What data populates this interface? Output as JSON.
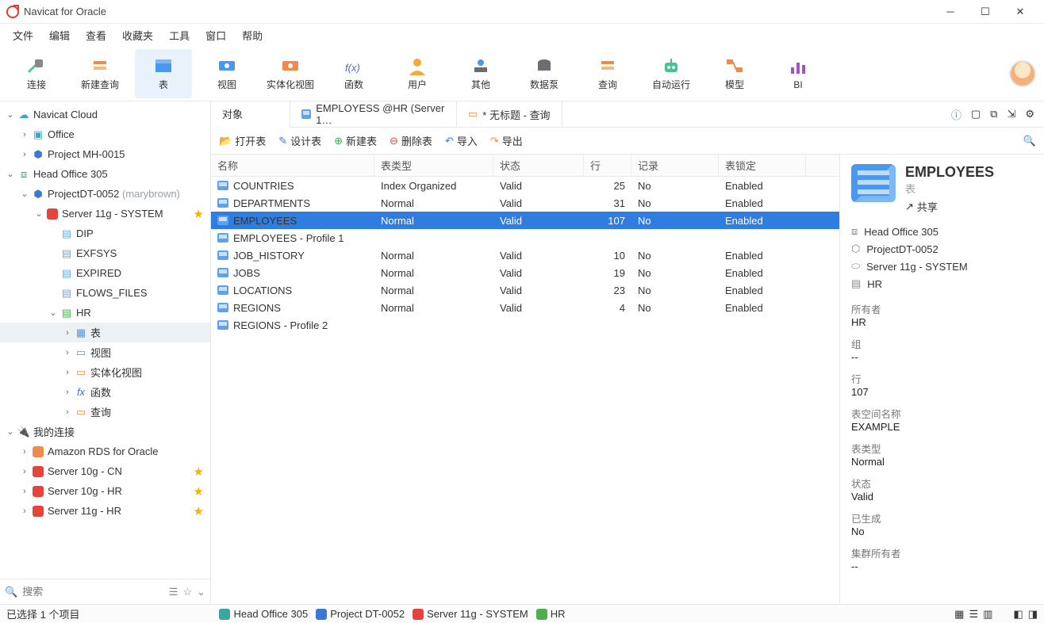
{
  "window": {
    "title": "Navicat for Oracle"
  },
  "menu": [
    "文件",
    "编辑",
    "查看",
    "收藏夹",
    "工具",
    "窗口",
    "帮助"
  ],
  "toolbar": [
    {
      "label": "连接",
      "icon": "plug",
      "color": "#55c29b"
    },
    {
      "label": "新建查询",
      "icon": "query",
      "color": "#f08a4b"
    },
    {
      "label": "表",
      "icon": "table",
      "color": "#4a97ef",
      "active": true
    },
    {
      "label": "视图",
      "icon": "view",
      "color": "#4a97ef"
    },
    {
      "label": "实体化视图",
      "icon": "mview",
      "color": "#f08a4b"
    },
    {
      "label": "函数",
      "icon": "fx",
      "color": "#5866d6"
    },
    {
      "label": "用户",
      "icon": "user",
      "color": "#f4a93a"
    },
    {
      "label": "其他",
      "icon": "other",
      "color": "#4a97ef"
    },
    {
      "label": "数据泵",
      "icon": "pump",
      "color": "#6b6d72"
    },
    {
      "label": "查询",
      "icon": "query2",
      "color": "#f08a4b"
    },
    {
      "label": "自动运行",
      "icon": "robot",
      "color": "#45c490"
    },
    {
      "label": "模型",
      "icon": "model",
      "color": "#f08a4b"
    },
    {
      "label": "BI",
      "icon": "bi",
      "color": "#a451c8"
    }
  ],
  "tree": {
    "cloud": {
      "label": "Navicat Cloud",
      "items": [
        {
          "label": "Office",
          "icon": "folder"
        },
        {
          "label": "Project MH-0015",
          "icon": "project"
        }
      ]
    },
    "head": {
      "label": "Head Office 305",
      "project": {
        "label": "ProjectDT-0052",
        "user": "(marybrown)",
        "server": {
          "label": "Server 11g - SYSTEM",
          "starred": true,
          "schemas": [
            "DIP",
            "EXFSYS",
            "EXPIRED",
            "FLOWS_FILES"
          ],
          "hr": {
            "label": "HR",
            "children": [
              "表",
              "视图",
              "实体化视图",
              "函数",
              "查询"
            ],
            "selected": 0
          }
        }
      }
    },
    "my": {
      "label": "我的连接",
      "items": [
        {
          "label": "Amazon RDS for Oracle",
          "icon": "aws"
        },
        {
          "label": "Server 10g - CN",
          "icon": "ora",
          "star": true
        },
        {
          "label": "Server 10g - HR",
          "icon": "ora",
          "star": true
        },
        {
          "label": "Server 11g - HR",
          "icon": "ora",
          "star": true
        }
      ]
    }
  },
  "search_placeholder": "搜索",
  "tabs": [
    {
      "label": "对象"
    },
    {
      "label": "EMPLOYESS @HR (Server 1…",
      "icon": "table"
    },
    {
      "label": "* 无标题 - 查询",
      "icon": "query"
    }
  ],
  "tab_actions": [
    "打开表",
    "设计表",
    "新建表",
    "删除表",
    "导入",
    "导出"
  ],
  "grid": {
    "headers": [
      "名称",
      "表类型",
      "状态",
      "行",
      "记录",
      "表锁定"
    ],
    "rows": [
      {
        "name": "COUNTRIES",
        "type": "Index Organized",
        "status": "Valid",
        "rows": "25",
        "log": "No",
        "lock": "Enabled"
      },
      {
        "name": "DEPARTMENTS",
        "type": "Normal",
        "status": "Valid",
        "rows": "31",
        "log": "No",
        "lock": "Enabled"
      },
      {
        "name": "EMPLOYEES",
        "type": "Normal",
        "status": "Valid",
        "rows": "107",
        "log": "No",
        "lock": "Enabled",
        "selected": true
      },
      {
        "name": "EMPLOYEES - Profile 1",
        "type": "",
        "status": "",
        "rows": "",
        "log": "",
        "lock": ""
      },
      {
        "name": "JOB_HISTORY",
        "type": "Normal",
        "status": "Valid",
        "rows": "10",
        "log": "No",
        "lock": "Enabled"
      },
      {
        "name": "JOBS",
        "type": "Normal",
        "status": "Valid",
        "rows": "19",
        "log": "No",
        "lock": "Enabled"
      },
      {
        "name": "LOCATIONS",
        "type": "Normal",
        "status": "Valid",
        "rows": "23",
        "log": "No",
        "lock": "Enabled"
      },
      {
        "name": "REGIONS",
        "type": "Normal",
        "status": "Valid",
        "rows": "4",
        "log": "No",
        "lock": "Enabled"
      },
      {
        "name": "REGIONS - Profile 2",
        "type": "",
        "status": "",
        "rows": "",
        "log": "",
        "lock": ""
      }
    ]
  },
  "detail": {
    "title": "EMPLOYEES",
    "subtitle": "表",
    "share": "共享",
    "meta": [
      {
        "icon": "office",
        "text": "Head Office 305"
      },
      {
        "icon": "project",
        "text": "ProjectDT-0052"
      },
      {
        "icon": "server",
        "text": "Server 11g - SYSTEM"
      },
      {
        "icon": "schema",
        "text": "HR"
      }
    ],
    "props": [
      {
        "k": "所有者",
        "v": "HR"
      },
      {
        "k": "组",
        "v": "--"
      },
      {
        "k": "行",
        "v": "107"
      },
      {
        "k": "表空间名称",
        "v": "EXAMPLE"
      },
      {
        "k": "表类型",
        "v": "Normal"
      },
      {
        "k": "状态",
        "v": "Valid"
      },
      {
        "k": "已生成",
        "v": "No"
      },
      {
        "k": "集群所有者",
        "v": "--"
      }
    ]
  },
  "status": {
    "left": "已选择 1 个项目",
    "crumbs": [
      {
        "label": "Head Office 305",
        "color": "#3aa6a0"
      },
      {
        "label": "Project DT-0052",
        "color": "#3a77d6"
      },
      {
        "label": "Server 11g - SYSTEM",
        "color": "#e5443b"
      },
      {
        "label": "HR",
        "color": "#4cae4c"
      }
    ]
  }
}
